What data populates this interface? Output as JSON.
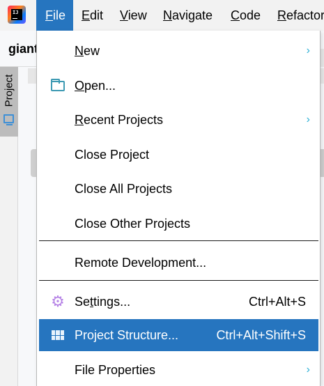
{
  "app": {
    "logo_text": "IJ"
  },
  "menubar": {
    "items": [
      {
        "label": "File",
        "mnemonic": "F",
        "rest": "ile"
      },
      {
        "label": "Edit",
        "mnemonic": "E",
        "rest": "dit"
      },
      {
        "label": "View",
        "mnemonic": "V",
        "rest": "iew"
      },
      {
        "label": "Navigate",
        "mnemonic": "N",
        "rest": "avigate"
      },
      {
        "label": "Code",
        "mnemonic": "C",
        "rest": "ode"
      },
      {
        "label": "Refactor",
        "mnemonic": "R",
        "rest": "efactor"
      }
    ],
    "active": "File"
  },
  "toolbar": {
    "project_name": "giant"
  },
  "sidebar": {
    "tab_label": "Project",
    "tab_icon": "monitor-icon"
  },
  "file_menu": {
    "items": [
      {
        "label": "New",
        "mnemonic": "N",
        "rest": "ew",
        "submenu": true
      },
      {
        "label": "Open...",
        "mnemonic": "O",
        "rest": "pen...",
        "icon": "folder-icon"
      },
      {
        "label": "Recent Projects",
        "mnemonic": "R",
        "rest": "ecent Projects",
        "submenu": true
      },
      {
        "label": "Close Project"
      },
      {
        "label": "Close All Projects"
      },
      {
        "label": "Close Other Projects"
      },
      {
        "label": "Remote Development..."
      },
      {
        "label": "Settings...",
        "pre": "Se",
        "mnemonic": "t",
        "rest": "tings...",
        "shortcut": "Ctrl+Alt+S",
        "icon": "gear-icon"
      },
      {
        "label": "Project Structure...",
        "shortcut": "Ctrl+Alt+Shift+S",
        "icon": "grid-icon",
        "highlighted": true
      },
      {
        "label": "File Properties",
        "submenu": true
      }
    ],
    "submenu_arrow": "›"
  },
  "colors": {
    "menu_active": "#2675bf",
    "submenu_arrow": "#2eb0d6",
    "gear_icon": "#b683e6",
    "folder_icon": "#3d9ab3"
  }
}
